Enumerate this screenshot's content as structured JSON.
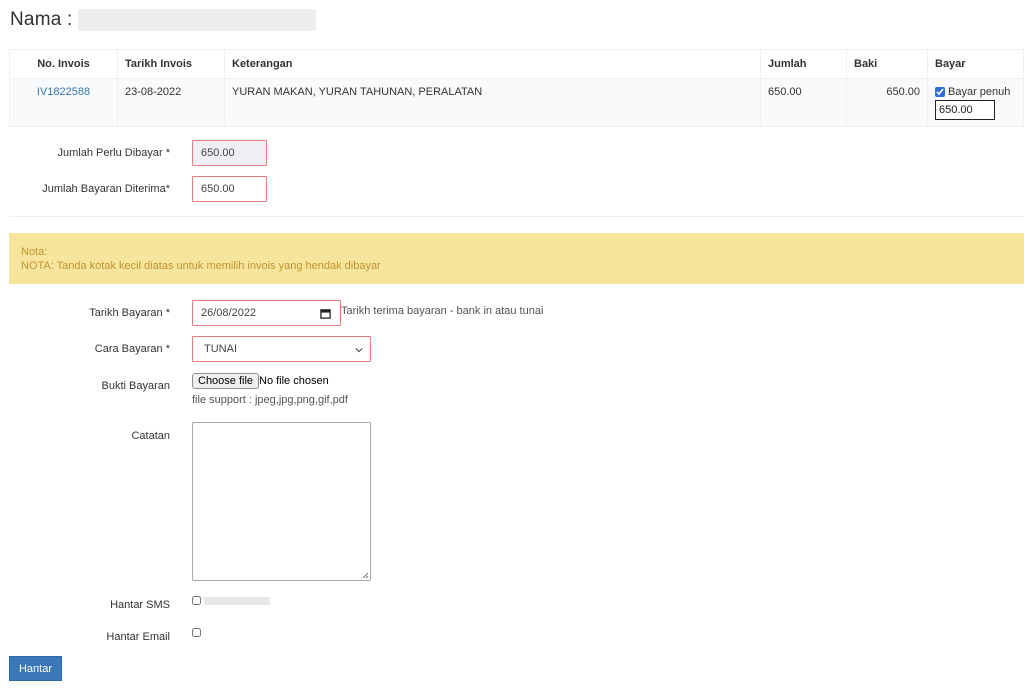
{
  "header": {
    "name_label": "Nama :"
  },
  "table": {
    "columns": [
      "No. Invois",
      "Tarikh Invois",
      "Keterangan",
      "Jumlah",
      "Baki",
      "Bayar"
    ],
    "rows": [
      {
        "invoice_no": "IV1822588",
        "invoice_date": "23-08-2022",
        "description": "YURAN MAKAN, YURAN TAHUNAN, PERALATAN",
        "amount": "650.00",
        "balance": "650.00",
        "full_pay_label": "Bayar penuh",
        "full_pay_checked": true,
        "pay_value": "650.00"
      }
    ]
  },
  "amount_due": {
    "label": "Jumlah Perlu Dibayar *",
    "value": "650.00"
  },
  "amount_received": {
    "label": "Jumlah Bayaran Diterima*",
    "value": "650.00"
  },
  "note": {
    "title": "Nota:",
    "text": "NOTA: Tanda kotak kecil diatas untuk memilih invois yang hendak dibayar"
  },
  "payment_date": {
    "label": "Tarikh Bayaran *",
    "value": "26/08/2022",
    "hint": "Tarikh terima bayaran - bank in atau tunai"
  },
  "payment_method": {
    "label": "Cara Bayaran *",
    "value": "TUNAI"
  },
  "payment_proof": {
    "label": "Bukti Bayaran",
    "button": "Choose file",
    "status": "No file chosen",
    "support": "file support : jpeg,jpg,png,gif,pdf"
  },
  "notes_field": {
    "label": "Catatan"
  },
  "send_sms": {
    "label": "Hantar SMS"
  },
  "send_email": {
    "label": "Hantar Email"
  },
  "submit": {
    "label": "Hantar"
  },
  "colors": {
    "error_border": "#e87f7f",
    "note_bg": "#f7e49d",
    "note_text": "#c19532",
    "link": "#337ab7",
    "primary": "#3a78b9"
  }
}
